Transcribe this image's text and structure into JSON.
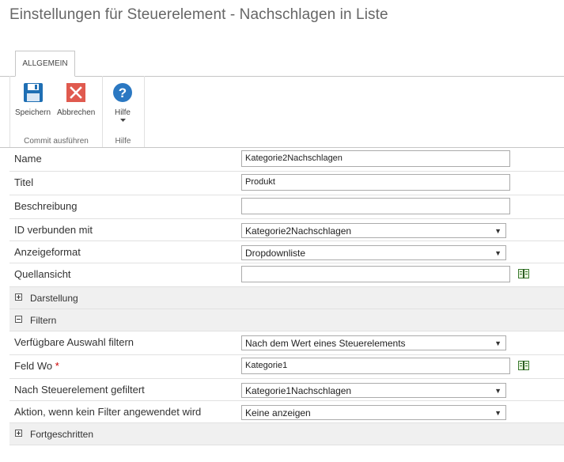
{
  "page": {
    "title": "Einstellungen für Steuerelement - Nachschlagen in Liste"
  },
  "ribbon": {
    "tab": "ALLGEMEIN",
    "groups": [
      {
        "label": "Commit ausführen",
        "buttons": [
          {
            "label": "Speichern",
            "icon": "save-icon"
          },
          {
            "label": "Abbrechen",
            "icon": "close-icon"
          }
        ]
      },
      {
        "label": "Hilfe",
        "buttons": [
          {
            "label": "Hilfe",
            "icon": "help-icon"
          }
        ]
      }
    ]
  },
  "form": {
    "name": {
      "label": "Name",
      "value": "Kategorie2Nachschlagen"
    },
    "titel": {
      "label": "Titel",
      "value": "Produkt"
    },
    "beschreibung": {
      "label": "Beschreibung",
      "value": ""
    },
    "id_verbunden": {
      "label": "ID verbunden mit",
      "value": "Kategorie2Nachschlagen"
    },
    "anzeigeformat": {
      "label": "Anzeigeformat",
      "value": "Dropdownliste"
    },
    "quellansicht": {
      "label": "Quellansicht",
      "value": ""
    },
    "section_darstellung": {
      "label": "Darstellung",
      "expanded": false
    },
    "section_filtern": {
      "label": "Filtern",
      "expanded": true
    },
    "auswahl_filtern": {
      "label": "Verfügbare Auswahl filtern",
      "value": "Nach dem Wert eines Steuerelements"
    },
    "feld_wo": {
      "label": "Feld Wo",
      "required_mark": "*",
      "value": "Kategorie1"
    },
    "nach_steuerelement": {
      "label": "Nach Steuerelement gefiltert",
      "value": "Kategorie1Nachschlagen"
    },
    "aktion_kein_filter": {
      "label": "Aktion, wenn kein Filter angewendet wird",
      "value": "Keine anzeigen"
    },
    "section_fortgeschritten": {
      "label": "Fortgeschritten",
      "expanded": false
    }
  },
  "colors": {
    "save": "#1f6fb4",
    "cancel": "#e05a4f",
    "help": "#2b78c2",
    "required": "#cc0000"
  }
}
